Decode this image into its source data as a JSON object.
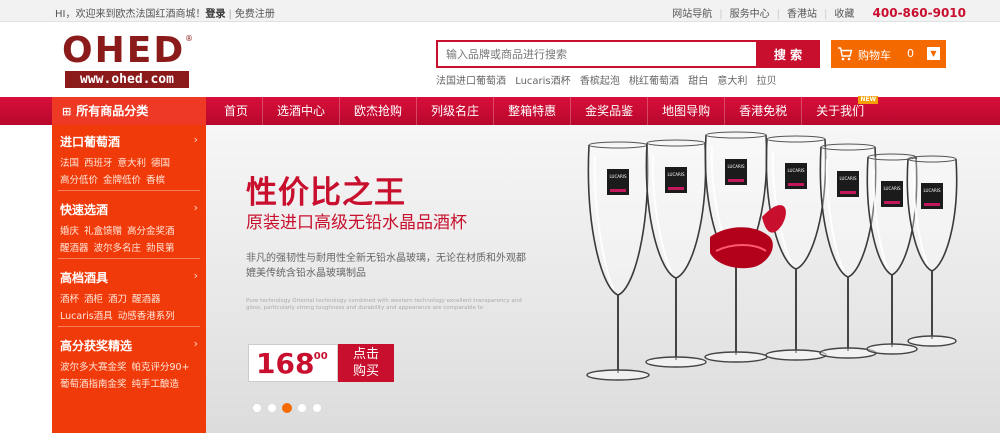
{
  "topbar": {
    "greeting": "HI，欢迎来到欧杰法国红酒商城！",
    "login": "登录",
    "register": "免费注册",
    "links": [
      "网站导航",
      "服务中心",
      "香港站",
      "收藏"
    ],
    "phone": "400-860-9010"
  },
  "logo": {
    "brand": "OHED",
    "reg": "®",
    "url": "www.ohed.com"
  },
  "search": {
    "placeholder": "输入品牌或商品进行搜索",
    "button": "搜 索",
    "hotwords": [
      "法国进口葡萄酒",
      "Lucaris酒杯",
      "香槟起泡",
      "桃红葡萄酒",
      "甜白",
      "意大利",
      "拉贝"
    ]
  },
  "cart": {
    "label": "购物车",
    "count": "0",
    "dropdown": "▼"
  },
  "nav": {
    "all_categories": "所有商品分类",
    "items": [
      "首页",
      "选酒中心",
      "欧杰抢购",
      "列级名庄",
      "整箱特惠",
      "金奖品鉴",
      "地图导购",
      "香港免税",
      "关于我们"
    ],
    "new_tag": "NEW"
  },
  "sidebar": {
    "categories": [
      {
        "title": "进口葡萄酒",
        "rows": [
          [
            "法国",
            "西班牙",
            "意大利",
            "德国"
          ],
          [
            "高分低价",
            "金牌低价",
            "香槟"
          ]
        ]
      },
      {
        "title": "快速选酒",
        "rows": [
          [
            "婚庆",
            "礼盒馈赠",
            "高分金奖酒"
          ],
          [
            "醒酒器",
            "波尔多名庄",
            "勃艮第"
          ]
        ]
      },
      {
        "title": "高档酒具",
        "rows": [
          [
            "酒杯",
            "酒柜",
            "酒刀",
            "醒酒器"
          ],
          [
            "Lucaris酒具",
            "动感香港系列"
          ]
        ]
      },
      {
        "title": "高分获奖精选",
        "rows": [
          [
            "波尔多大赛金奖",
            "帕克评分90+"
          ],
          [
            "葡萄酒指南金奖",
            "纯手工酿造"
          ]
        ]
      }
    ]
  },
  "banner": {
    "headline": "性价比之王",
    "subhead": "原装进口高级无铅水晶品酒杯",
    "desc": "非凡的强韧性与耐用性全新无铅水晶玻璃，无论在材质和外观都媲美传统含铅水晶玻璃制品",
    "english": "Pure technology Oriental technology combined with western technology excellent transparency and gloss, particularly strong toughness and durability and appearance are comparable to",
    "price_main": "168",
    "price_dec": ".00",
    "buy": "点击\n购买",
    "glass_brand": "LUCARIS",
    "slides": 5,
    "active_slide": 3
  },
  "colors": {
    "brand_red": "#c8102e",
    "nav_red": "#d80f3a",
    "sidebar_orange": "#f03a0a",
    "cart_orange": "#f46a00"
  }
}
